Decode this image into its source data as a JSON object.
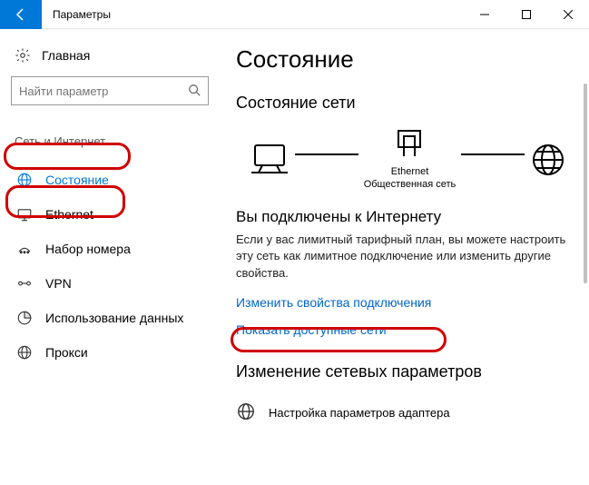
{
  "titlebar": {
    "title": "Параметры"
  },
  "sidebar": {
    "home_label": "Главная",
    "search_placeholder": "Найти параметр",
    "section_heading": "Сеть и Интернет",
    "items": [
      {
        "label": "Состояние"
      },
      {
        "label": "Ethernet"
      },
      {
        "label": "Набор номера"
      },
      {
        "label": "VPN"
      },
      {
        "label": "Использование данных"
      },
      {
        "label": "Прокси"
      }
    ]
  },
  "main": {
    "page_title": "Состояние",
    "section_title": "Состояние сети",
    "diagram": {
      "middle_label": "Ethernet",
      "middle_sub": "Общественная сеть"
    },
    "connected_title": "Вы подключены к Интернету",
    "connected_body": "Если у вас лимитный тарифный план, вы можете настроить эту сеть как лимитное подключение или изменить другие свойства.",
    "link_change_props": "Изменить свойства подключения",
    "link_show_networks": "Показать доступные сети",
    "change_params_title": "Изменение сетевых параметров",
    "adapter_label": "Настройка параметров адаптера"
  }
}
